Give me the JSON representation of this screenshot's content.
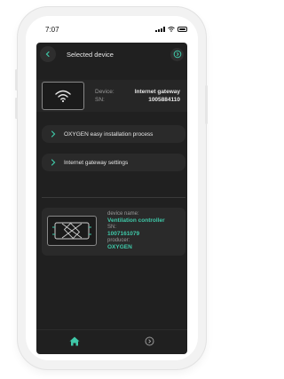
{
  "status_bar": {
    "time": "7:07"
  },
  "header": {
    "title": "Selected device",
    "back_icon": "chevron-left-icon",
    "action_icon": "circle-arrow-right-icon"
  },
  "gateway": {
    "icon": "wifi-icon",
    "device_label": "Device:",
    "device_value": "Internet gateway",
    "sn_label": "SN:",
    "sn_value": "1005884110"
  },
  "menu": [
    {
      "label": "OXYGEN easy installation process",
      "icon": "chevron-right-icon"
    },
    {
      "label": "Internet gateway settings",
      "icon": "chevron-right-icon"
    }
  ],
  "controller": {
    "icon": "ventilation-unit-icon",
    "name_label": "device name:",
    "name_value": "Ventilation controller",
    "sn_label": "SN:",
    "sn_value": "1007161079",
    "producer_label": "producer:",
    "producer_value": "OXYGEN"
  },
  "bottom_nav": [
    {
      "icon": "home-icon",
      "active": true
    },
    {
      "icon": "circle-arrow-right-icon",
      "active": false
    }
  ],
  "colors": {
    "accent": "#3fc8a8",
    "background": "#202020",
    "card": "#2a2a2a"
  }
}
